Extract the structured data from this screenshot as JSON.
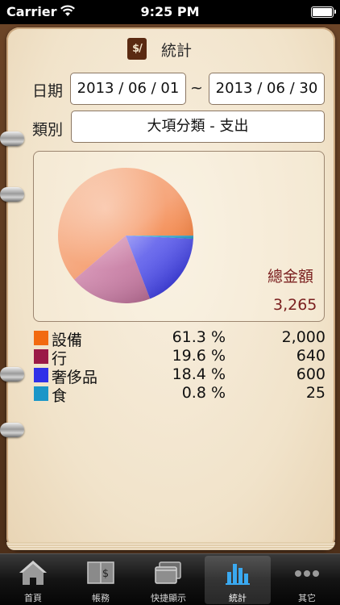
{
  "status_bar": {
    "carrier": "Carrier",
    "time": "9:25 PM"
  },
  "header": {
    "logo": "$/",
    "title": "統計"
  },
  "filters": {
    "date_label": "日期",
    "start_date": "2013 / 06 / 01",
    "separator": "~",
    "end_date": "2013 / 06 / 30",
    "category_label": "類別",
    "category_value": "大項分類 - 支出"
  },
  "summary": {
    "total_label": "總金額",
    "total_value": "3,265"
  },
  "chart_data": {
    "type": "pie",
    "categories": [
      "設備",
      "行",
      "奢侈品",
      "食"
    ],
    "values": [
      2000,
      640,
      600,
      25
    ],
    "percentages": [
      61.3,
      19.6,
      18.4,
      0.8
    ],
    "colors": [
      "#f4792b",
      "#c48aa8",
      "#5454e0",
      "#3aa6c6"
    ]
  },
  "legend": [
    {
      "name": "設備",
      "percent": "61.3 %",
      "amount": "2,000",
      "color": "#f26a10"
    },
    {
      "name": "行",
      "percent": "19.6 %",
      "amount": "640",
      "color": "#9b1a47"
    },
    {
      "name": "奢侈品",
      "percent": "18.4 %",
      "amount": "600",
      "color": "#3030e8"
    },
    {
      "name": "食",
      "percent": "0.8 %",
      "amount": "25",
      "color": "#1b96c8"
    }
  ],
  "tabs": [
    {
      "label": "首頁",
      "icon": "home-icon",
      "selected": false
    },
    {
      "label": "帳務",
      "icon": "ledger-icon",
      "selected": false
    },
    {
      "label": "快捷顯示",
      "icon": "windows-icon",
      "selected": false
    },
    {
      "label": "統計",
      "icon": "bar-chart-icon",
      "selected": true
    },
    {
      "label": "其它",
      "icon": "more-icon",
      "selected": false
    }
  ]
}
